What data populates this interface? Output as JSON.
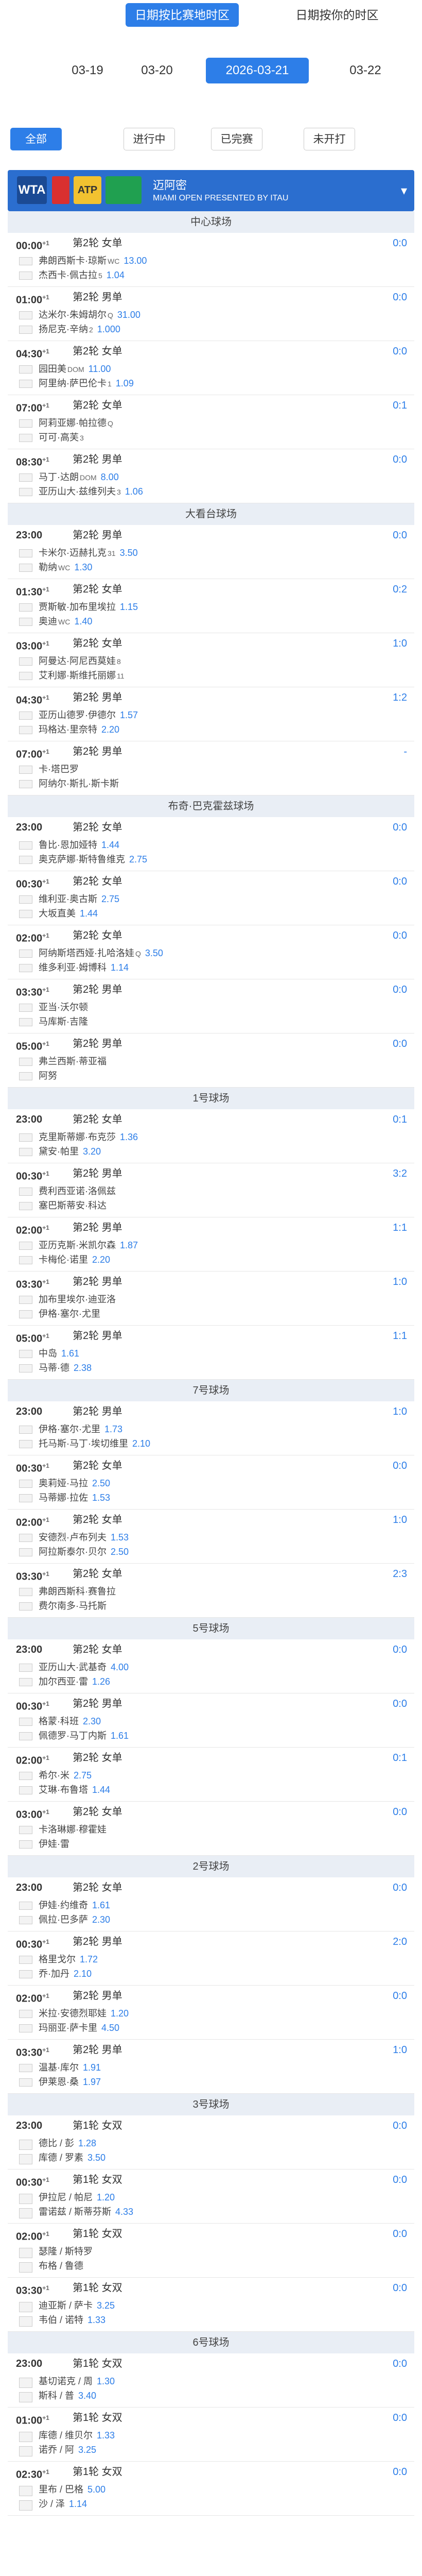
{
  "tz": {
    "a": "日期按比赛地时区",
    "b": "日期按你的时区"
  },
  "dates": [
    "03-19",
    "03-20",
    "2026-03-21",
    "03-22"
  ],
  "filters": [
    "全部",
    "进行中",
    "已完赛",
    "未开打"
  ],
  "banner": {
    "title": "迈阿密",
    "sub": "MIAMI OPEN PRESENTED BY ITAU",
    "logo1": "WTA",
    "logo3": "ATP"
  },
  "sections": [
    {
      "court": "中心球场",
      "matches": [
        {
          "time": "00:00",
          "sup": "+1",
          "round": "第2轮 女单",
          "score": "0:0",
          "p1": "弗朗西斯卡·琼斯",
          "s1": "WC",
          "o1": "13.00",
          "p2": "杰西卡·佩古拉",
          "s2": "5",
          "o2": "1.04"
        },
        {
          "time": "01:00",
          "sup": "+1",
          "round": "第2轮 男单",
          "score": "0:0",
          "p1": "达米尔·朱姆胡尔",
          "s1": "Q",
          "o1": "31.00",
          "p2": "扬尼克·辛纳",
          "s2": "2",
          "o2": "1.000"
        },
        {
          "time": "04:30",
          "sup": "+1",
          "round": "第2轮 女单",
          "score": "0:0",
          "p1": "园田美",
          "s1": "DOM",
          "o1": "11.00",
          "p2": "阿里纳·萨巴伦卡",
          "s2": "1",
          "o2": "1.09"
        },
        {
          "time": "07:00",
          "sup": "+1",
          "round": "第2轮 女单",
          "score": "0:1",
          "p1": "阿莉亚娜·帕拉德",
          "s1": "Q",
          "o1": "",
          "p2": "可可·高芙",
          "s2": "3",
          "o2": ""
        },
        {
          "time": "08:30",
          "sup": "+1",
          "round": "第2轮 男单",
          "score": "0:0",
          "p1": "马丁·达朗",
          "s1": "DOM",
          "o1": "8.00",
          "p2": "亚历山大·兹维列夫",
          "s2": "3",
          "o2": "1.06"
        }
      ]
    },
    {
      "court": "大看台球场",
      "matches": [
        {
          "time": "23:00",
          "sup": "",
          "round": "第2轮 男单",
          "score": "0:0",
          "p1": "卡米尔·迈赫扎克",
          "s1": "31",
          "o1": "3.50",
          "p2": "勒纳",
          "s2": "WC",
          "o2": "1.30"
        },
        {
          "time": "01:30",
          "sup": "+1",
          "round": "第2轮 女单",
          "score": "0:2",
          "p1": "贾斯敏·加布里埃拉",
          "s1": "",
          "o1": "1.15",
          "p2": "奥迪",
          "s2": "WC",
          "o2": "1.40"
        },
        {
          "time": "03:00",
          "sup": "+1",
          "round": "第2轮 女单",
          "score": "1:0",
          "p1": "阿曼达·阿尼西莫娃",
          "s1": "8",
          "o1": "",
          "p2": "艾利娜·斯维托丽娜",
          "s2": "11",
          "o2": ""
        },
        {
          "time": "04:30",
          "sup": "+1",
          "round": "第2轮 男单",
          "score": "1:2",
          "p1": "亚历山德罗·伊德尔",
          "s1": "",
          "o1": "1.57",
          "p2": "玛格达·里奈特",
          "s2": "",
          "o2": "2.20"
        },
        {
          "time": "07:00",
          "sup": "+1",
          "round": "第2轮 男单",
          "score": "-",
          "p1": "卡·塔巴罗",
          "s1": "",
          "o1": "",
          "p2": "阿纳尔·斯扎·斯卡斯",
          "s2": "",
          "o2": ""
        }
      ]
    },
    {
      "court": "布奇·巴克霍兹球场",
      "matches": [
        {
          "time": "23:00",
          "sup": "",
          "round": "第2轮 女单",
          "score": "0:0",
          "p1": "鲁比·恩加娅特",
          "s1": "",
          "o1": "1.44",
          "p2": "奥克萨娜·斯特鲁维克",
          "s2": "",
          "o2": "2.75"
        },
        {
          "time": "00:30",
          "sup": "+1",
          "round": "第2轮 女单",
          "score": "0:0",
          "p1": "维利亚·奥古斯",
          "s1": "",
          "o1": "2.75",
          "p2": "大坂直美",
          "s2": "",
          "o2": "1.44"
        },
        {
          "time": "02:00",
          "sup": "+1",
          "round": "第2轮 女单",
          "score": "0:0",
          "p1": "阿纳斯塔西娅·扎哈洛娃",
          "s1": "Q",
          "o1": "3.50",
          "p2": "维多利亚·姆博科",
          "s2": "",
          "o2": "1.14"
        },
        {
          "time": "03:30",
          "sup": "+1",
          "round": "第2轮 男单",
          "score": "0:0",
          "p1": "亚当·沃尔顿",
          "s1": "",
          "o1": "",
          "p2": "马库斯·吉隆",
          "s2": "",
          "o2": ""
        },
        {
          "time": "05:00",
          "sup": "+1",
          "round": "第2轮 男单",
          "score": "0:0",
          "p1": "弗兰西斯·蒂亚福",
          "s1": "",
          "o1": "",
          "p2": "阿努",
          "s2": "",
          "o2": ""
        }
      ]
    },
    {
      "court": "1号球场",
      "matches": [
        {
          "time": "23:00",
          "sup": "",
          "round": "第2轮 女单",
          "score": "0:1",
          "p1": "克里斯蒂娜·布克莎",
          "s1": "",
          "o1": "1.36",
          "p2": "黛安·帕里",
          "s2": "",
          "o2": "3.20"
        },
        {
          "time": "00:30",
          "sup": "+1",
          "round": "第2轮 男单",
          "score": "3:2",
          "p1": "费利西亚诺·洛佩兹",
          "s1": "",
          "o1": "",
          "p2": "塞巴斯蒂安·科达",
          "s2": "",
          "o2": ""
        },
        {
          "time": "02:00",
          "sup": "+1",
          "round": "第2轮 男单",
          "score": "1:1",
          "p1": "亚历克斯·米凯尔森",
          "s1": "",
          "o1": "1.87",
          "p2": "卡梅伦·诺里",
          "s2": "",
          "o2": "2.20"
        },
        {
          "time": "03:30",
          "sup": "+1",
          "round": "第2轮 男单",
          "score": "1:0",
          "p1": "加布里埃尔·迪亚洛",
          "s1": "",
          "o1": "",
          "p2": "伊格·塞尔·尤里",
          "s2": "",
          "o2": ""
        },
        {
          "time": "05:00",
          "sup": "+1",
          "round": "第2轮 男单",
          "score": "1:1",
          "p1": "中岛",
          "s1": "",
          "o1": "1.61",
          "p2": "马蒂·德",
          "s2": "",
          "o2": "2.38"
        }
      ]
    },
    {
      "court": "7号球场",
      "matches": [
        {
          "time": "23:00",
          "sup": "",
          "round": "第2轮 男单",
          "score": "1:0",
          "p1": "伊格·塞尔·尤里",
          "s1": "",
          "o1": "1.73",
          "p2": "托马斯·马丁·埃切维里",
          "s2": "",
          "o2": "2.10"
        },
        {
          "time": "00:30",
          "sup": "+1",
          "round": "第2轮 女单",
          "score": "0:0",
          "p1": "奥莉娅·马拉",
          "s1": "",
          "o1": "2.50",
          "p2": "马蒂娜·拉佐",
          "s2": "",
          "o2": "1.53"
        },
        {
          "time": "02:00",
          "sup": "+1",
          "round": "第2轮 女单",
          "score": "1:0",
          "p1": "安德烈·卢布列夫",
          "s1": "",
          "o1": "1.53",
          "p2": "阿拉斯泰尔·贝尔",
          "s2": "",
          "o2": "2.50"
        },
        {
          "time": "03:30",
          "sup": "+1",
          "round": "第2轮 女单",
          "score": "2:3",
          "p1": "弗朗西斯科·赛鲁拉",
          "s1": "",
          "o1": "",
          "p2": "费尔南多·马托斯",
          "s2": "",
          "o2": ""
        }
      ]
    },
    {
      "court": "5号球场",
      "matches": [
        {
          "time": "23:00",
          "sup": "",
          "round": "第2轮 女单",
          "score": "0:0",
          "p1": "亚历山大·武基奇",
          "s1": "",
          "o1": "4.00",
          "p2": "加尔西亚·雷",
          "s2": "",
          "o2": "1.26"
        },
        {
          "time": "00:30",
          "sup": "+1",
          "round": "第2轮 男单",
          "score": "0:0",
          "p1": "格蒙·科班",
          "s1": "",
          "o1": "2.30",
          "p2": "佩德罗·马丁内斯",
          "s2": "",
          "o2": "1.61"
        },
        {
          "time": "02:00",
          "sup": "+1",
          "round": "第2轮 女单",
          "score": "0:1",
          "p1": "希尔·米",
          "s1": "",
          "o1": "2.75",
          "p2": "艾琳·布鲁塔",
          "s2": "",
          "o2": "1.44"
        },
        {
          "time": "03:00",
          "sup": "+1",
          "round": "第2轮 女单",
          "score": "0:0",
          "p1": "卡洛琳娜·穆霍娃",
          "s1": "",
          "o1": "",
          "p2": "伊娃·雷",
          "s2": "",
          "o2": ""
        }
      ]
    },
    {
      "court": "2号球场",
      "matches": [
        {
          "time": "23:00",
          "sup": "",
          "round": "第2轮 女单",
          "score": "0:0",
          "p1": "伊娃·约维奇",
          "s1": "",
          "o1": "1.61",
          "p2": "佩拉·巴多萨",
          "s2": "",
          "o2": "2.30"
        },
        {
          "time": "00:30",
          "sup": "+1",
          "round": "第2轮 男单",
          "score": "2:0",
          "p1": "格里戈尔",
          "s1": "",
          "o1": "1.72",
          "p2": "乔·加丹",
          "s2": "",
          "o2": "2.10"
        },
        {
          "time": "02:00",
          "sup": "+1",
          "round": "第2轮 男单",
          "score": "0:0",
          "p1": "米拉·安德烈耶娃",
          "s1": "",
          "o1": "1.20",
          "p2": "玛丽亚·萨卡里",
          "s2": "",
          "o2": "4.50"
        },
        {
          "time": "03:30",
          "sup": "+1",
          "round": "第2轮 男单",
          "score": "1:0",
          "p1": "温基·库尔",
          "s1": "",
          "o1": "1.91",
          "p2": "伊莱恩·桑",
          "s2": "",
          "o2": "1.97"
        }
      ]
    },
    {
      "court": "3号球场",
      "matches": [
        {
          "time": "23:00",
          "sup": "",
          "round": "第1轮 女双",
          "score": "0:0",
          "p1": "德比 / 彭",
          "s1": "",
          "o1": "1.28",
          "p2": "库德 / 罗素",
          "s2": "",
          "o2": "3.50"
        },
        {
          "time": "00:30",
          "sup": "+1",
          "round": "第1轮 女双",
          "score": "0:0",
          "p1": "伊拉尼 / 帕尼",
          "s1": "",
          "o1": "1.20",
          "p2": "雷诺兹 / 斯蒂芬斯",
          "s2": "",
          "o2": "4.33"
        },
        {
          "time": "02:00",
          "sup": "+1",
          "round": "第1轮 女双",
          "score": "0:0",
          "p1": "瑟隆 / 斯特罗",
          "s1": "",
          "o1": "",
          "p2": "布格 / 鲁德",
          "s2": "",
          "o2": ""
        },
        {
          "time": "03:30",
          "sup": "+1",
          "round": "第1轮 女双",
          "score": "0:0",
          "p1": "迪亚斯 / 萨卡",
          "s1": "",
          "o1": "3.25",
          "p2": "韦伯 / 诺特",
          "s2": "",
          "o2": "1.33"
        }
      ]
    },
    {
      "court": "6号球场",
      "matches": [
        {
          "time": "23:00",
          "sup": "",
          "round": "第1轮 女双",
          "score": "0:0",
          "p1": "基切诺克 / 周",
          "s1": "",
          "o1": "1.30",
          "p2": "斯科 / 普",
          "s2": "",
          "o2": "3.40"
        },
        {
          "time": "01:00",
          "sup": "+1",
          "round": "第1轮 女双",
          "score": "0:0",
          "p1": "库德 / 维贝尔",
          "s1": "",
          "o1": "1.33",
          "p2": "诺乔 / 阿",
          "s2": "",
          "o2": "3.25"
        },
        {
          "time": "02:30",
          "sup": "+1",
          "round": "第1轮 女双",
          "score": "0:0",
          "p1": "里布 / 巴格",
          "s1": "",
          "o1": "5.00",
          "p2": "沙 / 泽",
          "s2": "",
          "o2": "1.14"
        }
      ]
    }
  ]
}
